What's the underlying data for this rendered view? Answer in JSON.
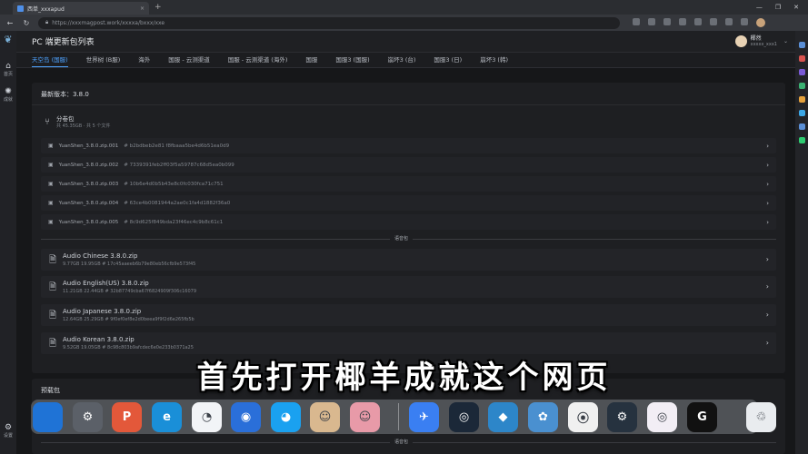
{
  "browser": {
    "tab_title": "西单_xxxapud",
    "tab_close": "×",
    "tab_add": "+",
    "url": "https://xxxmagpost.work/xxxxa/bxxx/xxe",
    "win_min": "—",
    "win_max": "❐",
    "win_close": "✕"
  },
  "sidebar": {
    "items": [
      {
        "label": "首页",
        "icon": "home-icon",
        "glyph": "⌂"
      },
      {
        "label": "成就",
        "icon": "achievement-icon",
        "glyph": "✺"
      }
    ],
    "footer": {
      "label": "设置",
      "icon": "settings-icon",
      "glyph": "⚙"
    }
  },
  "header": {
    "title": "PC 端更新包列表",
    "user_name": "椰然",
    "user_sub": "xxxxx_xxx1",
    "user_chevron": "⌄"
  },
  "tabs": [
    {
      "label": "天空岛 (国服)",
      "active": true
    },
    {
      "label": "世界树 (B服)",
      "active": false
    },
    {
      "label": "海外",
      "active": false
    },
    {
      "label": "国服 - 云测渠道",
      "active": false
    },
    {
      "label": "国服 - 云测渠道 (海外)",
      "active": false
    },
    {
      "label": "国服",
      "active": false
    },
    {
      "label": "国服3 (国服)",
      "active": false
    },
    {
      "label": "崩坏3 (台)",
      "active": false
    },
    {
      "label": "国服3 (日)",
      "active": false
    },
    {
      "label": "崩坏3 (韩)",
      "active": false
    }
  ],
  "main": {
    "version_label": "最新版本：3.8.0",
    "group": {
      "title": "分卷包",
      "meta": "共 45.35GB  ·  共 5 个文件"
    },
    "volumes": [
      {
        "name": "YuanShen_3.8.0.zip.001",
        "hash": "# b2bdbeb2e81 f8fbaaa5be4d6b51ea0d9"
      },
      {
        "name": "YuanShen_3.8.0.zip.002",
        "hash": "# 7339391feb2ff03f5a59787c68d5ea0b099"
      },
      {
        "name": "YuanShen_3.8.0.zip.003",
        "hash": "# 10b6e4d0b5b43e8c0fc030fca71c751"
      },
      {
        "name": "YuanShen_3.8.0.zip.004",
        "hash": "# 63ce4b0081944a2ae0c1fa4d1882f36a0"
      },
      {
        "name": "YuanShen_3.8.0.zip.005",
        "hash": "# 8c9d625f849bda23f46ec4c9b8c61c1"
      }
    ],
    "divider_label": "语音包",
    "audio": [
      {
        "name": "Audio Chinese 3.8.0.zip",
        "size": "9.77GB",
        "unzipped": "19.95GB",
        "hash": "# 17c45aaeeb6b79e80eb56cfb9e573f45"
      },
      {
        "name": "Audio English(US) 3.8.0.zip",
        "size": "11.21GB",
        "unzipped": "22.44GB",
        "hash": "# 32b87749cba67f6824909f306c16079"
      },
      {
        "name": "Audio Japanese 3.8.0.zip",
        "size": "12.64GB",
        "unzipped": "25.29GB",
        "hash": "# 9f0ef0ef8e2d0beea9f9f2d6e265fb5b"
      },
      {
        "name": "Audio Korean 3.8.0.zip",
        "size": "9.52GB",
        "unzipped": "19.05GB",
        "hash": "# 8c98c803b9afcdec6e0e233b0371a25"
      }
    ],
    "chevron": "›",
    "panel2_label": "预载包",
    "panel2_divider": "语音包"
  },
  "subtitle": "首先打开椰羊成就这个网页",
  "dock": {
    "apps": [
      {
        "name": "finder",
        "glyph": "",
        "color": "#1f73d6"
      },
      {
        "name": "system-settings",
        "glyph": "⚙",
        "color": "#5b6068"
      },
      {
        "name": "wps-office",
        "glyph": "P",
        "color": "#e3583a"
      },
      {
        "name": "edge",
        "glyph": "e",
        "color": "#1a8fd8"
      },
      {
        "name": "cloud-drive",
        "glyph": "◔",
        "color": "#f2f4f7"
      },
      {
        "name": "screenshot",
        "glyph": "◉",
        "color": "#2a6fd9"
      },
      {
        "name": "qq",
        "glyph": "◕",
        "color": "#1aa1f0"
      },
      {
        "name": "genshin-1",
        "glyph": "☺",
        "color": "#d9b88f"
      },
      {
        "name": "genshin-2",
        "glyph": "☺",
        "color": "#e89aa8"
      },
      {
        "name": "feishu",
        "glyph": "✈",
        "color": "#3a7ff2"
      },
      {
        "name": "steam",
        "glyph": "◎",
        "color": "#1b2838"
      },
      {
        "name": "code-editor",
        "glyph": "◆",
        "color": "#2d86c9"
      },
      {
        "name": "gear-app",
        "glyph": "✿",
        "color": "#4a90d0"
      },
      {
        "name": "fly-app",
        "glyph": "⦿",
        "color": "#f0f0f0"
      },
      {
        "name": "cheat-engine",
        "glyph": "⚙",
        "color": "#26323f"
      },
      {
        "name": "osu-app",
        "glyph": "◎",
        "color": "#f2eef5"
      },
      {
        "name": "g-app",
        "glyph": "G",
        "color": "#111111"
      },
      {
        "name": "trash",
        "glyph": "♲",
        "color": "#e9ecef"
      }
    ]
  }
}
